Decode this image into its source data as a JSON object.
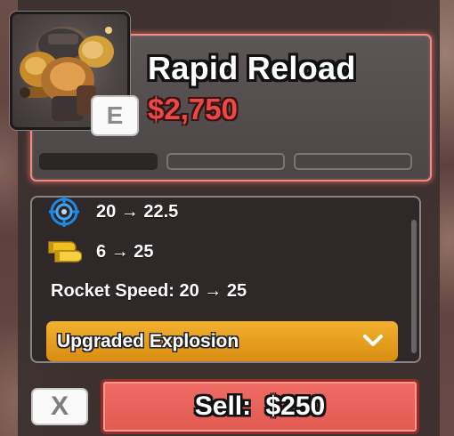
{
  "upgrade": {
    "title": "Rapid Reload",
    "price": "$2,750",
    "rarity_letter": "E",
    "progress": {
      "filled": 1,
      "total": 3
    }
  },
  "stats": [
    {
      "icon": "crosshair-icon",
      "text": "20 → 22.5"
    },
    {
      "icon": "bullets-icon",
      "text": "6 → 25"
    },
    {
      "icon": null,
      "text": "Rocket Speed: 20 → 25"
    }
  ],
  "dropdown": {
    "label": "Upgraded Explosion",
    "icon": "chevron-down-icon"
  },
  "actions": {
    "close_label": "X",
    "sell_label": "Sell: $250"
  },
  "colors": {
    "accent_red": "#ec4848",
    "sell_button": "#e8625a",
    "dropdown_gold": "#e9a020",
    "card_glow": "#f08a85",
    "crosshair_blue": "#1e88e5",
    "bullet_gold": "#f0c020"
  }
}
